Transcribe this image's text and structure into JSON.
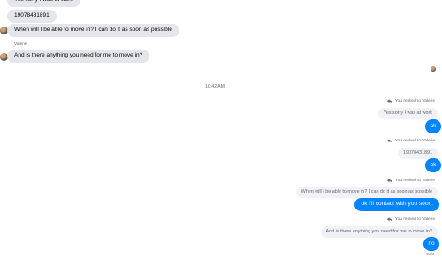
{
  "incoming": {
    "msg1": "Yes sorry I was at work",
    "msg2": "19078431891",
    "msg3": "When will I be able to move in? I can do it as soon as possible",
    "sender_name": "Valerie",
    "msg4": "And is there anything you need for me to move in?"
  },
  "divider_time": "10:42 AM",
  "replies": [
    {
      "label": "You replied to Valerie",
      "quoted": "Yes sorry I was at work",
      "reply": "ok"
    },
    {
      "label": "You replied to Valerie",
      "quoted": "19078431891",
      "reply": "ok"
    },
    {
      "label": "You replied to Valerie",
      "quoted": "When will I be able to move in? I can do it as soon as possible",
      "reply": "ok i'll contact with you soon."
    },
    {
      "label": "You replied to Valerie",
      "quoted": "And is there anything you need for me to move in?",
      "reply": "no"
    }
  ],
  "status": "Sent",
  "colors": {
    "outgoing": "#0084ff",
    "incoming": "#e4e6eb",
    "quote": "#f0f2f5",
    "meta_text": "#65676b"
  },
  "icons": {
    "reply": "reply-arrow-icon"
  }
}
